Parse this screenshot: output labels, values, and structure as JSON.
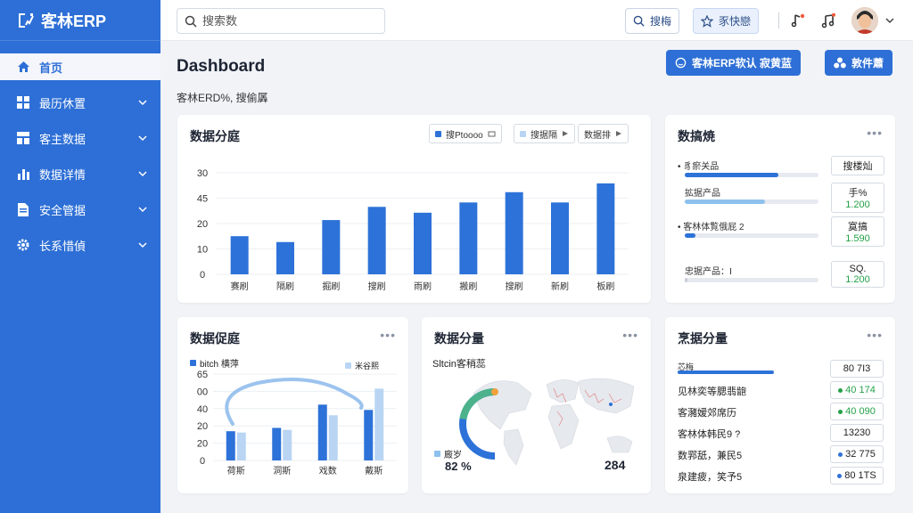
{
  "app": {
    "brand": "客林ERP"
  },
  "sidebar": {
    "items": [
      {
        "label": "首页",
        "icon": "home-icon",
        "active": true
      },
      {
        "label": "最历休置",
        "icon": "grid-icon"
      },
      {
        "label": "客主数据",
        "icon": "layout-icon"
      },
      {
        "label": "数据详情",
        "icon": "bar-chart-icon"
      },
      {
        "label": "安全管据",
        "icon": "document-icon"
      },
      {
        "label": "长系惜偵",
        "icon": "gear-icon"
      }
    ]
  },
  "topbar": {
    "search_placeholder": "搜索数",
    "search_button": "搜梅",
    "star_button": "豕快戀"
  },
  "header": {
    "title": "Dashboard",
    "subtitle": "客林ERD%, 搜偷羼",
    "btn_primary": "客林ERP软认 寂黄蓝",
    "btn_secondary": "敦件蕭"
  },
  "card1": {
    "title": "数据分庭",
    "chips": [
      "搜Ptoooo",
      "搜据隔",
      "数据排"
    ],
    "chart_data": {
      "type": "bar",
      "yticks": [
        "30",
        "45",
        "20",
        "10",
        "0"
      ],
      "categories": [
        "赛刷",
        "隔刷",
        "掘刷",
        "搜刷",
        "雨刷",
        "搬刷",
        "搜刷",
        "新刷",
        "板刷"
      ],
      "values": [
        13,
        11,
        18.5,
        23,
        21,
        24.5,
        28,
        24.5,
        31
      ],
      "ylim": [
        0,
        45
      ],
      "color": "#2d72d8"
    }
  },
  "card2": {
    "title": "数搞焼",
    "rows": [
      {
        "label": "豸瘀关品",
        "fill": 0.7,
        "color": "#2d72d8",
        "value": "搜楼灿",
        "value2": ""
      },
      {
        "label": "拡据产品",
        "fill": 0.6,
        "color": "#8ec1ee",
        "value": "手%",
        "value2": "1.200"
      },
      {
        "label": "客林体覧俄屁 2",
        "fill": 0.08,
        "color": "#2d72d8",
        "value": "寞搞",
        "value2": "1.590"
      },
      {
        "label": "忠据产品：Ⅰ",
        "fill": 0.02,
        "color": "#c8cdd6",
        "value": "SQ.",
        "value2": "1.200"
      }
    ]
  },
  "card3": {
    "title": "数据促庭",
    "legend": [
      "bitch 横萍",
      "米谷熙"
    ],
    "chart_data": {
      "type": "bar",
      "yticks": [
        "65",
        "00",
        "40",
        "20",
        "20",
        "0"
      ],
      "categories": [
        "荷斯",
        "洞斯",
        "戏数",
        "戴斯"
      ],
      "series": [
        {
          "name": "bitch 横萍",
          "values": [
            22,
            24.5,
            42,
            38
          ],
          "color": "#2d72d8"
        },
        {
          "name": "米谷熙",
          "values": [
            21,
            23,
            34,
            54
          ],
          "color": "#b9d5f3"
        }
      ],
      "ylim": [
        0,
        65
      ]
    }
  },
  "card4": {
    "title": "数据分量",
    "map_label": "Sltcin客稍蕊",
    "legend": "廄岁",
    "percent": "82 %",
    "value": "284",
    "gauge_fraction": 0.82
  },
  "card5": {
    "title": "烹据分量",
    "bar_label": "芯梅",
    "rows": [
      {
        "label": "",
        "value": "80 7I3",
        "dot": ""
      },
      {
        "label": "见林奕等腮翡龅",
        "value": "40 174",
        "dot": "#24a148"
      },
      {
        "label": "客瀦嫒郊席历",
        "value": "40 090",
        "dot": "#24a148"
      },
      {
        "label": "客林体韩民9 ?",
        "value": "13230",
        "dot": ""
      },
      {
        "label": "数郛舐，兼民5",
        "value": "32 775",
        "dot": "#2d72d8"
      },
      {
        "label": "泉建疲，笑予5",
        "value": "80 1TS",
        "dot": "#2d72d8"
      }
    ]
  }
}
